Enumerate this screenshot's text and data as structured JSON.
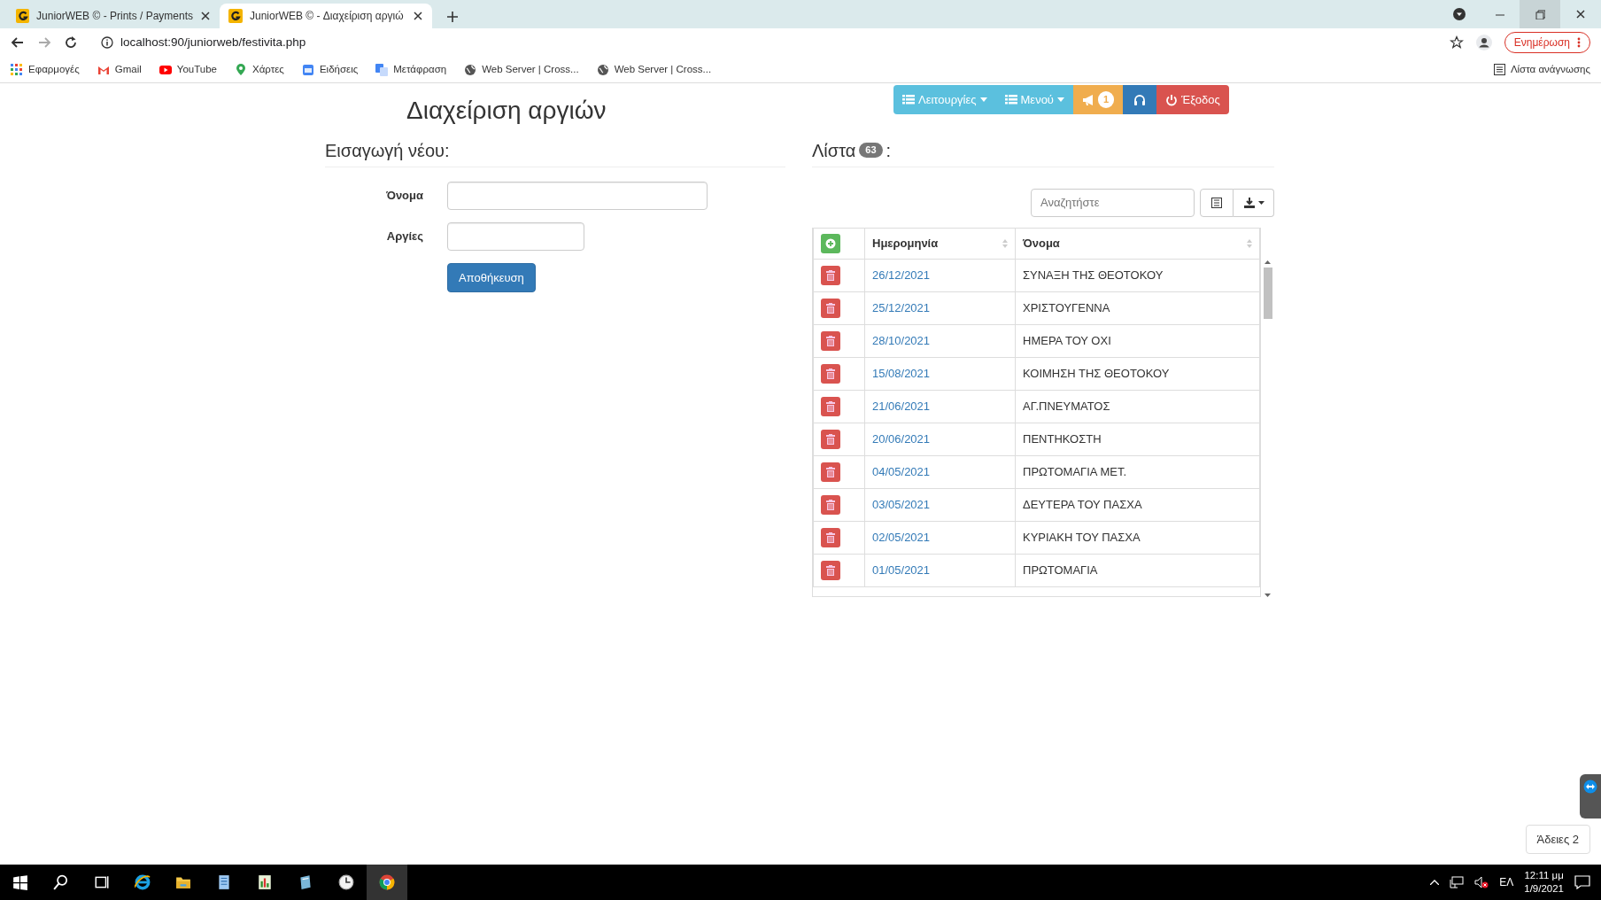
{
  "browser": {
    "tabs": [
      {
        "title": "JuniorWEB © - Prints / Payments",
        "selected": false
      },
      {
        "title": "JuniorWEB © - Διαχείριση αργιώ",
        "selected": true
      }
    ],
    "address": "localhost:90/juniorweb/festivita.php",
    "bookmarks": [
      {
        "label": "Εφαρμογές",
        "kind": "apps"
      },
      {
        "label": "Gmail",
        "kind": "gmail"
      },
      {
        "label": "YouTube",
        "kind": "youtube"
      },
      {
        "label": "Χάρτες",
        "kind": "maps"
      },
      {
        "label": "Ειδήσεις",
        "kind": "news"
      },
      {
        "label": "Μετάφραση",
        "kind": "translate"
      },
      {
        "label": "Web Server | Cross...",
        "kind": "globe"
      },
      {
        "label": "Web Server | Cross...",
        "kind": "globe"
      }
    ],
    "update_button": "Ενημέρωση",
    "reading_list": "Λίστα ανάγνωσης"
  },
  "nav_buttons": [
    {
      "label": "Λειτουργίες",
      "kind": "menu"
    },
    {
      "label": "Μενού",
      "kind": "menu"
    },
    {
      "kind": "alerts",
      "badge": "1"
    },
    {
      "kind": "support"
    },
    {
      "label": "Έξοδος",
      "kind": "logout"
    }
  ],
  "title": "Διαχείριση αργιών",
  "form": {
    "heading": "Εισαγωγή νέου:",
    "fields": [
      {
        "label": "Όνομα"
      },
      {
        "label": "Αργίες"
      }
    ],
    "save_button": "Αποθήκευση"
  },
  "list": {
    "heading": "Λίστα",
    "count": "63",
    "suffix": ":",
    "search": {
      "placeholder": "Αναζητήστε"
    },
    "table": {
      "columns": [
        "Ημερομηνία",
        "Όνομα"
      ],
      "rows": [
        {
          "date": "26/12/2021",
          "name": "ΣΥΝΑΞΗ ΤΗΣ ΘΕΟΤΟΚΟΥ"
        },
        {
          "date": "25/12/2021",
          "name": "ΧΡΙΣΤΟΥΓΕΝΝΑ"
        },
        {
          "date": "28/10/2021",
          "name": "ΗΜΕΡΑ ΤΟΥ ΟΧΙ"
        },
        {
          "date": "15/08/2021",
          "name": "ΚΟΙΜΗΣΗ ΤΗΣ ΘΕΟΤΟΚΟΥ"
        },
        {
          "date": "21/06/2021",
          "name": "ΑΓ.ΠΝΕΥΜΑΤΟΣ"
        },
        {
          "date": "20/06/2021",
          "name": "ΠΕΝΤΗΚΟΣΤΗ"
        },
        {
          "date": "04/05/2021",
          "name": "ΠΡΩΤΟΜΑΓΙΑ ΜΕΤ."
        },
        {
          "date": "03/05/2021",
          "name": "ΔΕΥΤΕΡΑ ΤΟΥ ΠΑΣΧΑ"
        },
        {
          "date": "02/05/2021",
          "name": "ΚΥΡΙΑΚΗ ΤΟΥ ΠΑΣΧΑ"
        },
        {
          "date": "01/05/2021",
          "name": "ΠΡΩΤΟΜΑΓΙΑ"
        }
      ]
    }
  },
  "leaves_button": "Άδειες 2",
  "taskbar": {
    "language": "ΕΛ",
    "time": "12:11 μμ",
    "date": "1/9/2021"
  }
}
